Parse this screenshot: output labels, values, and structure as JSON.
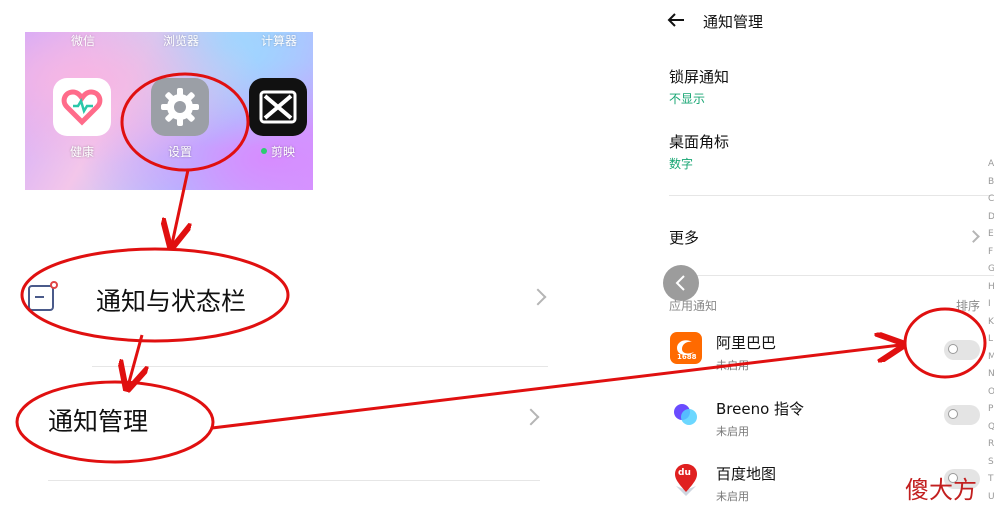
{
  "home_screen": {
    "top_labels": [
      "微信",
      "浏览器",
      "计算器"
    ],
    "apps": [
      {
        "label": "健康",
        "icon": "heart-icon"
      },
      {
        "label": "设置",
        "icon": "gear-icon"
      },
      {
        "label": "剪映",
        "icon": "capcut-icon"
      }
    ]
  },
  "settings_list": {
    "items": [
      {
        "label": "通知与状态栏",
        "icon": "notification-bar-icon"
      },
      {
        "label": "通知管理"
      }
    ]
  },
  "notification_management": {
    "title": "通知管理",
    "lock_screen": {
      "label": "锁屏通知",
      "value": "不显示"
    },
    "badge": {
      "label": "桌面角标",
      "value": "数字"
    },
    "more": {
      "label": "更多"
    },
    "section_header": "应用通知",
    "sort_label": "排序",
    "apps": [
      {
        "name": "阿里巴巴",
        "status": "未启用",
        "icon": "alibaba-1688-icon",
        "icon_text": "1688",
        "enabled": false
      },
      {
        "name": "Breeno 指令",
        "status": "未启用",
        "icon": "breeno-icon",
        "enabled": false
      },
      {
        "name": "百度地图",
        "status": "未启用",
        "icon": "baidu-map-icon",
        "icon_text": "du",
        "enabled": false
      }
    ],
    "alphabet_index": [
      "A",
      "B",
      "C",
      "D",
      "E",
      "F",
      "G",
      "H",
      "I",
      "K",
      "L",
      "M",
      "N",
      "O",
      "P",
      "Q",
      "R",
      "S",
      "T",
      "U"
    ]
  },
  "watermark": "傻大方",
  "colors": {
    "annotation_red": "#e01010",
    "accent_green": "#17a673",
    "alibaba_orange": "#ff6a00"
  }
}
